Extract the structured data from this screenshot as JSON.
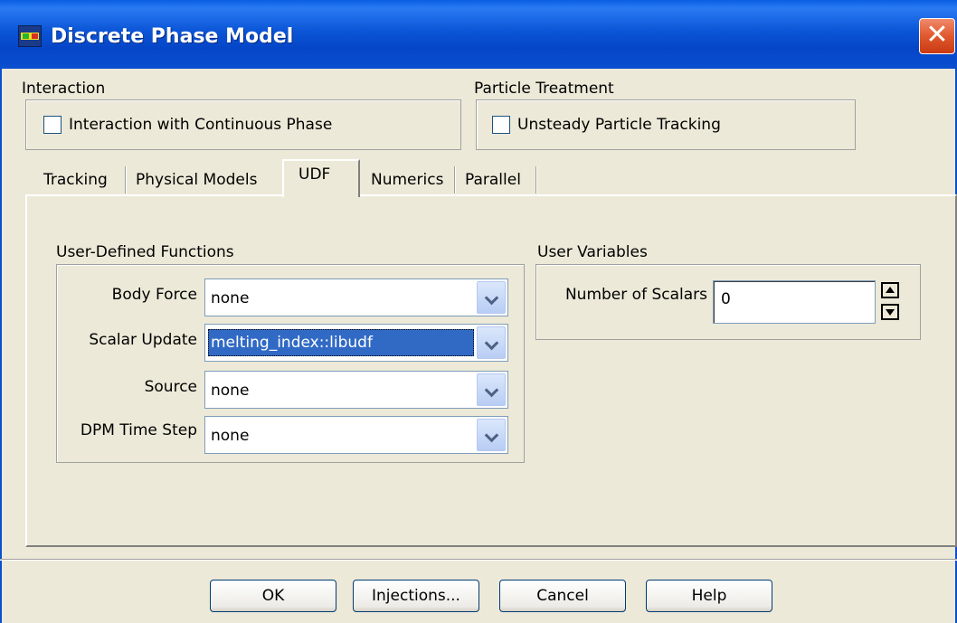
{
  "window": {
    "title": "Discrete Phase Model",
    "close_glyph": "✕"
  },
  "interaction": {
    "label": "Interaction",
    "checkbox_label": "Interaction with Continuous Phase",
    "checked": false
  },
  "particle_treatment": {
    "label": "Particle Treatment",
    "checkbox_label": "Unsteady Particle Tracking",
    "checked": false
  },
  "tabs": [
    {
      "label": "Tracking",
      "active": false
    },
    {
      "label": "Physical Models",
      "active": false
    },
    {
      "label": "UDF",
      "active": true
    },
    {
      "label": "Numerics",
      "active": false
    },
    {
      "label": "Parallel",
      "active": false
    }
  ],
  "udf": {
    "label": "User-Defined Functions",
    "rows": [
      {
        "label": "Body Force",
        "value": "none"
      },
      {
        "label": "Scalar Update",
        "value": "melting_index::libudf"
      },
      {
        "label": "Source",
        "value": "none"
      },
      {
        "label": "DPM Time Step",
        "value": "none"
      }
    ]
  },
  "user_variables": {
    "label": "User Variables",
    "scalars_label": "Number of Scalars",
    "scalars_value": "0"
  },
  "buttons": {
    "ok": "OK",
    "injections": "Injections...",
    "cancel": "Cancel",
    "help": "Help"
  },
  "colors": {
    "titlebar": "#0a4fcf",
    "dialog_bg": "#ece9d8",
    "selection": "#316ac5",
    "close": "#e0582e"
  }
}
